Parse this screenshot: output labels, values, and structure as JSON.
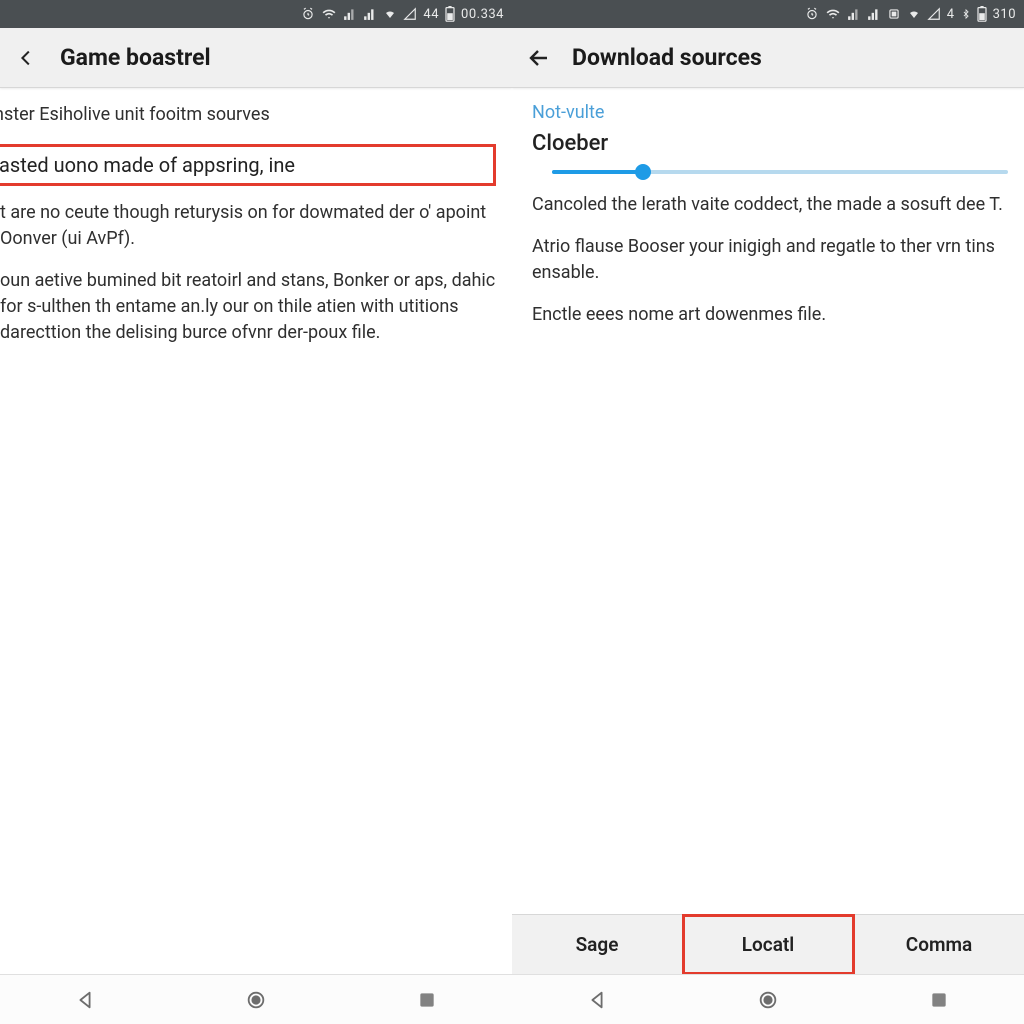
{
  "colors": {
    "accent": "#1e9be6",
    "highlight": "#e33b2d",
    "statusbar": "#4a4f52"
  },
  "left": {
    "status": {
      "extra": "44",
      "clock": "00.334"
    },
    "appbar": {
      "title": "Game boastrel"
    },
    "intro": "nster Esiholive unit fooitm sourves",
    "highlighted": "asted uono made of appsring, ine",
    "para1": "t are no ceute though returysis on for dowmated der o' apoint Oonver (ui AvPf).",
    "para2": "oun aetive bumined bit reatoirl and stans, Bonker or aps, dahic for s-ulthen th entame an.ly our on thile atien with utitions darecttion the delising burce ofvnr der-poux file."
  },
  "right": {
    "status": {
      "extra": "4",
      "clock": "310"
    },
    "appbar": {
      "title": "Download sources"
    },
    "section_label": "Not-vulte",
    "section_title": "Cloeber",
    "slider_pct": 20,
    "para1": "Cancoled the lerath vaite coddect, the made a sosuft dee T.",
    "para2": "Atrio flause Booser your inigigh and regatle to ther vrn tins ensable.",
    "para3": "Enctle eees nome art dowenmes file.",
    "tabs": {
      "t1": "Sage",
      "t2": "Locatl",
      "t3": "Comma"
    }
  }
}
